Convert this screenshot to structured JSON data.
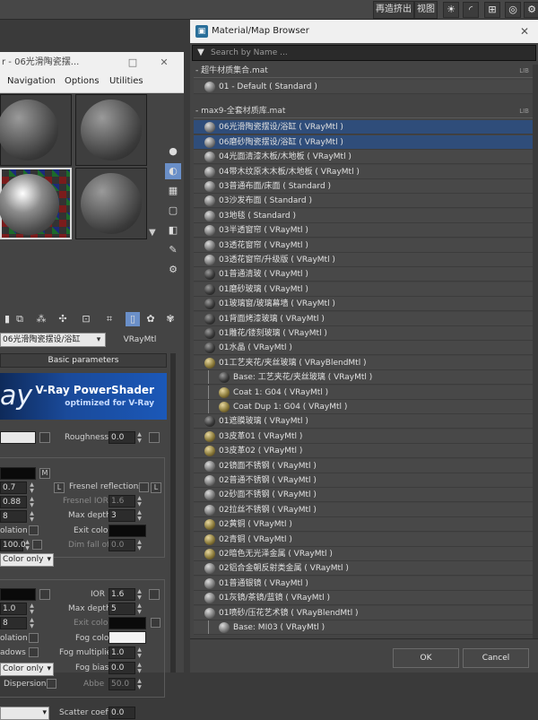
{
  "topbar": {
    "label": "再造挤出",
    "view": "视图",
    "icons": [
      "sun-icon",
      "curve-icon",
      "hierarchy-icon",
      "circle-icon",
      "gear-icon"
    ]
  },
  "material_editor": {
    "title": "r - 06光滑陶瓷摆...",
    "menu": [
      "Navigation",
      "Options",
      "Utilities"
    ],
    "material_name": "06光滑陶瓷摆设/浴缸",
    "material_type": "VRayMtl",
    "rollout": "Basic parameters",
    "banner": {
      "logo": "ay",
      "title": "V-Ray PowerShader",
      "subtitle": "optimized for V-Ray"
    },
    "fields": {
      "roughness_label": "Roughness",
      "roughness_value": "0.0",
      "m_label": "M",
      "refl_gloss_value": "0.7",
      "l_label": "L",
      "fresnel_reflections": "Fresnel reflections",
      "fresnel_ior_value": "0.88",
      "fresnel_ior_label": "Fresnel IOR",
      "fresnel_ior_right": "1.6",
      "subdivs_value": "8",
      "max_depth_label": "Max depth",
      "max_depth_value": "3",
      "exit_color_label": "Exit color",
      "interpolation_label": "olation",
      "dim_distance_value": "100.0",
      "dim_falloff_label": "Dim fall off",
      "dim_falloff_value": "0.0",
      "affect_channels_1": "Color only",
      "ior_label": "IOR",
      "ior_value": "1.6",
      "refr_gloss_value": "1.0",
      "refr_max_depth_label": "Max depth",
      "refr_max_depth_value": "5",
      "refr_subdivs_value": "8",
      "refr_exit_color_label": "Exit color",
      "fog_color_label": "Fog color",
      "refr_interp_label": "olation",
      "fog_multiplier_label": "Fog multiplier",
      "fog_multiplier_value": "1.0",
      "shadows_label": "adows",
      "fog_bias_label": "Fog bias",
      "fog_bias_value": "0.0",
      "affect_channels_2": "Color only",
      "dispersion_label": "Dispersion",
      "abbe_label": "Abbe",
      "abbe_value": "50.0",
      "scatter_coeff_label": "Scatter coeff",
      "scatter_value": "0.0"
    }
  },
  "browser": {
    "title": "Material/Map Browser",
    "search_placeholder": "Search by Name ...",
    "groups": [
      {
        "name": "- 超牛材质集合.mat",
        "tag": "LIB"
      },
      {
        "name": "- max9-全套材质库.mat",
        "tag": "LIB"
      }
    ],
    "group1_items": [
      {
        "label": "01 - Default ( Standard )",
        "icon": "sphere-icon"
      }
    ],
    "group2_items": [
      {
        "label": "06光滑陶瓷摆设/浴缸 ( VRayMtl )",
        "icon": "sphere-icon",
        "selected": true
      },
      {
        "label": "06磨砂陶瓷摆设/浴缸 ( VRayMtl )",
        "icon": "sphere-icon",
        "selected": true
      },
      {
        "label": "04光面清漆木板/木地板 ( VRayMtl )",
        "icon": "sphere-icon"
      },
      {
        "label": "04带木纹原木木板/木地板 ( VRayMtl )",
        "icon": "sphere-icon"
      },
      {
        "label": "03普通布面/床面 ( Standard )",
        "icon": "sphere-icon"
      },
      {
        "label": "03沙发布面 ( Standard )",
        "icon": "sphere-icon"
      },
      {
        "label": "03地毯 ( Standard )",
        "icon": "sphere-icon"
      },
      {
        "label": "03半透窗帘 ( VRayMtl )",
        "icon": "sphere-icon"
      },
      {
        "label": "03透花窗帘 ( VRayMtl )",
        "icon": "sphere-icon"
      },
      {
        "label": "03透花窗帘/升级版 ( VRayMtl )",
        "icon": "sphere-icon"
      },
      {
        "label": "01普通清玻 ( VRayMtl )",
        "icon": "dark-sphere-icon"
      },
      {
        "label": "01磨砂玻璃 ( VRayMtl )",
        "icon": "dark-sphere-icon"
      },
      {
        "label": "01玻璃窗/玻璃幕墙 ( VRayMtl )",
        "icon": "dark-sphere-icon"
      },
      {
        "label": "01背面烤漆玻璃 ( VRayMtl )",
        "icon": "dark-sphere-icon"
      },
      {
        "label": "01雕花/镂刻玻璃 ( VRayMtl )",
        "icon": "dark-sphere-icon"
      },
      {
        "label": "01水晶 ( VRayMtl )",
        "icon": "dark-sphere-icon"
      },
      {
        "label": "01工艺夹花/夹丝玻璃 ( VRayBlendMtl )",
        "icon": "gold-sphere-icon"
      },
      {
        "label": "Base: 工艺夹花/夹丝玻璃 ( VRayMtl )",
        "icon": "dark-sphere-icon",
        "indent": true
      },
      {
        "label": "Coat 1: G04 ( VRayMtl )",
        "icon": "gold-sphere-icon",
        "indent": true
      },
      {
        "label": "Coat Dup 1: G04 ( VRayMtl )",
        "icon": "gold-sphere-icon",
        "indent": true
      },
      {
        "label": "01遮膜玻璃 ( VRayMtl )",
        "icon": "dark-sphere-icon"
      },
      {
        "label": "03皮革01 ( VRayMtl )",
        "icon": "gold-sphere-icon"
      },
      {
        "label": "03皮革02 ( VRayMtl )",
        "icon": "gold-sphere-icon"
      },
      {
        "label": "02镜面不锈钢 ( VRayMtl )",
        "icon": "sphere-icon"
      },
      {
        "label": "02普通不锈钢 ( VRayMtl )",
        "icon": "sphere-icon"
      },
      {
        "label": "02砂面不锈钢 ( VRayMtl )",
        "icon": "sphere-icon"
      },
      {
        "label": "02拉丝不锈钢 ( VRayMtl )",
        "icon": "sphere-icon"
      },
      {
        "label": "02黄铜 ( VRayMtl )",
        "icon": "gold-sphere-icon"
      },
      {
        "label": "02青铜 ( VRayMtl )",
        "icon": "gold-sphere-icon"
      },
      {
        "label": "02暗色无光泽金属 ( VRayMtl )",
        "icon": "gold-sphere-icon"
      },
      {
        "label": "02铝合金朝反射类金属 ( VRayMtl )",
        "icon": "sphere-icon"
      },
      {
        "label": "01普通银镜 ( VRayMtl )",
        "icon": "sphere-icon"
      },
      {
        "label": "01灰镜/茶镜/蓝镜 ( VRayMtl )",
        "icon": "sphere-icon"
      },
      {
        "label": "01喷砂/压花艺术镜 ( VRayBlendMtl )",
        "icon": "sphere-icon"
      },
      {
        "label": "Base: MI03 ( VRayMtl )",
        "icon": "sphere-icon",
        "indent": true
      }
    ],
    "ok_label": "OK",
    "cancel_label": "Cancel"
  },
  "colors": {
    "accent_selected": "#2f4d7a",
    "vray_blue": "#1b58b8",
    "panel": "#444444"
  }
}
